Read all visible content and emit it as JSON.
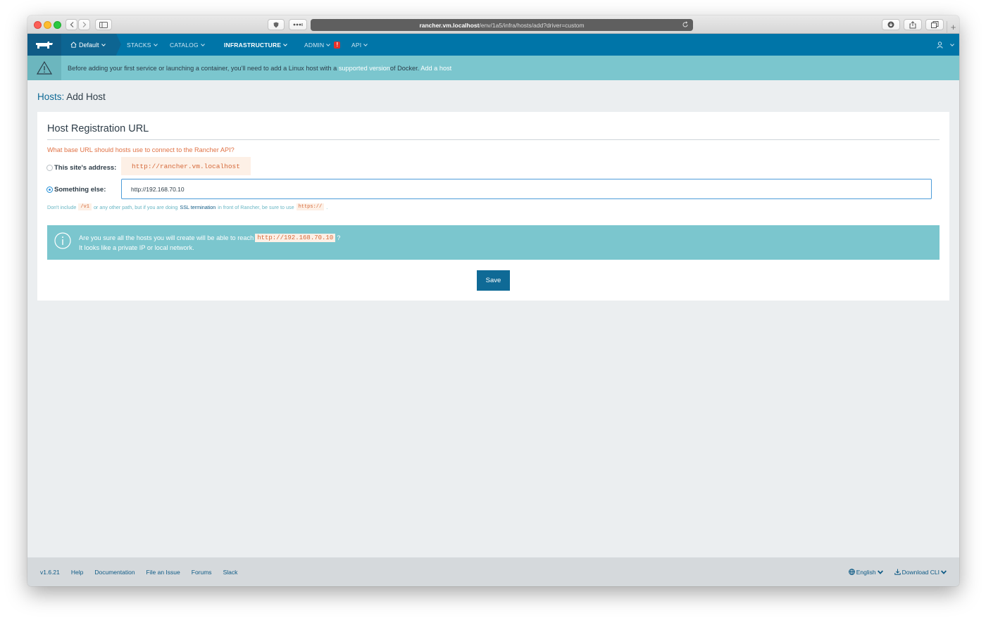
{
  "browser": {
    "url_host": "rancher.vm.localhost",
    "url_path": "/env/1a5/infra/hosts/add?driver=custom"
  },
  "nav": {
    "environment": "Default",
    "items": [
      {
        "label": "STACKS"
      },
      {
        "label": "CATALOG"
      },
      {
        "label": "INFRASTRUCTURE"
      },
      {
        "label": "ADMIN"
      },
      {
        "label": "API"
      }
    ],
    "admin_badge": "!"
  },
  "banner": {
    "text_before": "Before adding your first service or launching a container, you'll need to add a Linux host with a",
    "supported_link": "supported version",
    "text_after": "of Docker.",
    "add_host_link": "Add a host"
  },
  "page": {
    "title_prefix": "Hosts:",
    "title_rest": "Add Host"
  },
  "card": {
    "title": "Host Registration URL",
    "question": "What base URL should hosts use to connect to the Rancher API?",
    "site_address_label": "This site's address:",
    "site_address_value": "http://rancher.vm.localhost",
    "something_else_label": "Something else:",
    "something_else_value": "http://192.168.70.10",
    "help_before": "Don't include",
    "help_code1": "/v1",
    "help_mid": "or any other path, but if you are doing",
    "help_ssl": "SSL termination",
    "help_after": "in front of Rancher, be sure to use",
    "help_code2": "https://",
    "help_end": ".",
    "info_line1_before": "Are you sure all the hosts you will create will be able to reach",
    "info_code": "http://192.168.70.10",
    "info_line1_after": "?",
    "info_line2": "It looks like a private IP or local network.",
    "save_label": "Save"
  },
  "footer": {
    "version": "v1.6.21",
    "links": [
      "Help",
      "Documentation",
      "File an Issue",
      "Forums",
      "Slack"
    ],
    "language": "English",
    "download": "Download CLI"
  },
  "colors": {
    "nav": "#0075a8",
    "banner": "#7bc6ce",
    "accent_orange": "#e07245",
    "save": "#0f6a96"
  }
}
